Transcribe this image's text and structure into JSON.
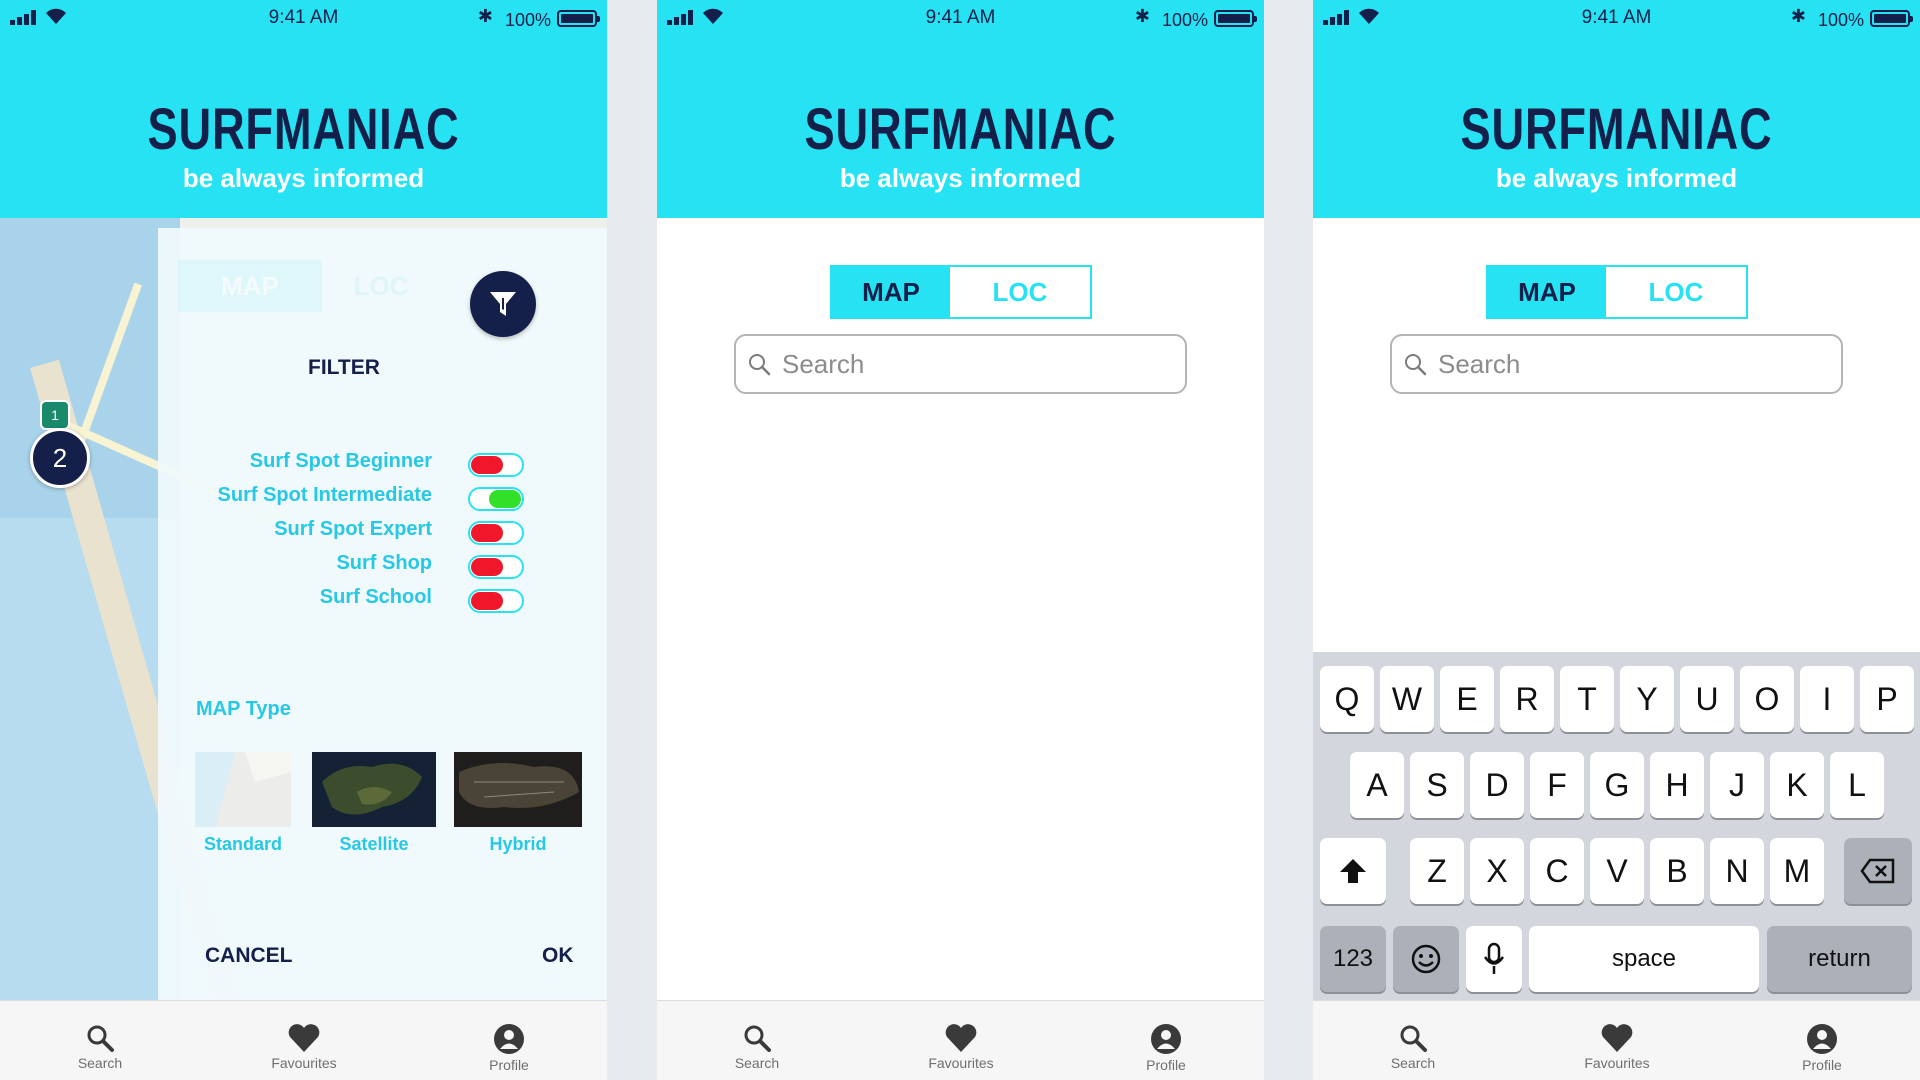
{
  "status_bar": {
    "time": "9:41 AM",
    "battery": "100%"
  },
  "header": {
    "title": "SURFMANIAC",
    "subtitle": "be always informed"
  },
  "segmented": {
    "map": "MAP",
    "loc": "LOC"
  },
  "search": {
    "placeholder": "Search"
  },
  "tabbar": {
    "search": "Search",
    "favourites": "Favourites",
    "profile": "Profile"
  },
  "map": {
    "cluster_count": "2",
    "pin_label": "1"
  },
  "filter": {
    "title": "FILTER",
    "options": [
      {
        "label": "Surf Spot Beginner",
        "enabled": false
      },
      {
        "label": "Surf Spot Intermediate",
        "enabled": true
      },
      {
        "label": "Surf Spot Expert",
        "enabled": false
      },
      {
        "label": "Surf Shop",
        "enabled": false
      },
      {
        "label": "Surf School",
        "enabled": false
      }
    ],
    "map_type_label": "MAP Type",
    "map_types": [
      "Standard",
      "Satellite",
      "Hybrid"
    ],
    "cancel": "CANCEL",
    "ok": "OK"
  },
  "keyboard": {
    "row1": [
      "Q",
      "W",
      "E",
      "R",
      "T",
      "Y",
      "U",
      "O",
      "I",
      "P"
    ],
    "row2": [
      "A",
      "S",
      "D",
      "F",
      "G",
      "H",
      "J",
      "K",
      "L"
    ],
    "row3": [
      "Z",
      "X",
      "C",
      "V",
      "B",
      "N",
      "M"
    ],
    "numbers": "123",
    "space": "space",
    "return": "return"
  },
  "colors": {
    "accent": "#27e2f3",
    "navy": "#14204a",
    "toggle_off": "#f0172a",
    "toggle_on": "#32e02a"
  },
  "icons": [
    "search-icon",
    "filter-icon",
    "heart-icon",
    "profile-icon",
    "shift-icon",
    "backspace-icon",
    "emoji-icon",
    "microphone-icon",
    "signal-icon",
    "wifi-icon",
    "bluetooth-icon",
    "battery-icon"
  ]
}
